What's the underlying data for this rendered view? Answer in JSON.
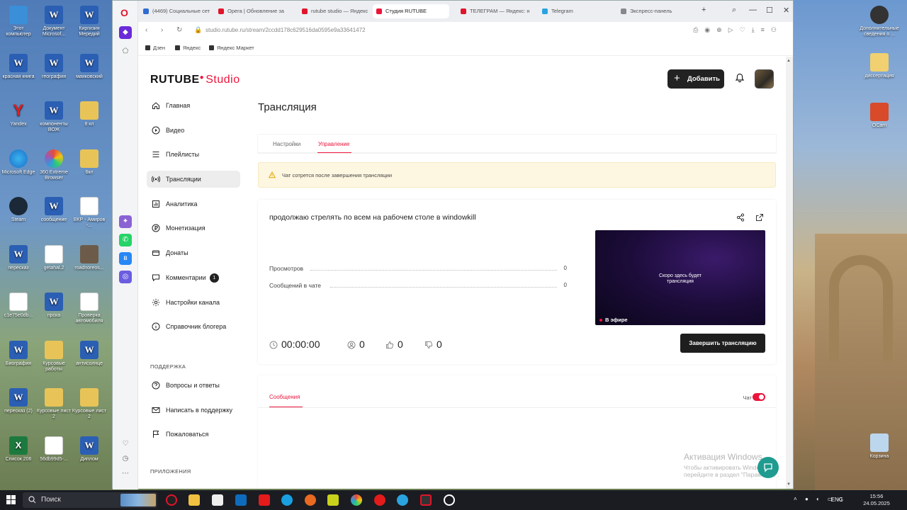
{
  "desktop": {
    "left_icons": [
      {
        "label": "Этот компьютер",
        "kind": "pc"
      },
      {
        "label": "Документ Microsof...",
        "kind": "w"
      },
      {
        "label": "Киргизия Мередий",
        "kind": "w"
      },
      {
        "label": "красная книга",
        "kind": "w"
      },
      {
        "label": "география",
        "kind": "w"
      },
      {
        "label": "маяковский",
        "kind": "w"
      },
      {
        "label": "Yandex",
        "kind": "y"
      },
      {
        "label": "компоненты ВОЖ",
        "kind": "w"
      },
      {
        "label": "8 кл",
        "kind": "f"
      },
      {
        "label": "Microsoft Edge",
        "kind": "c"
      },
      {
        "label": "360 Extreme Browser",
        "kind": "m"
      },
      {
        "label": "6кл",
        "kind": "f"
      },
      {
        "label": "Steam",
        "kind": "s"
      },
      {
        "label": "сообщение",
        "kind": "w"
      },
      {
        "label": "ВКР - Амиров -...",
        "kind": "d"
      },
      {
        "label": "пересказ",
        "kind": "w"
      },
      {
        "label": "getahal.2",
        "kind": "d"
      },
      {
        "label": "roadnoreos...",
        "kind": "p"
      },
      {
        "label": "c1e75e0db...",
        "kind": "d"
      },
      {
        "label": "прска",
        "kind": "w"
      },
      {
        "label": "Проверка автомобиля",
        "kind": "d"
      },
      {
        "label": "Биография",
        "kind": "w"
      },
      {
        "label": "Курсовые работы",
        "kind": "f"
      },
      {
        "label": "антисолнце",
        "kind": "w"
      },
      {
        "label": "пересказ (2)",
        "kind": "w"
      },
      {
        "label": "Курсовые лист 2",
        "kind": "f"
      },
      {
        "label": "Курсовые лист 2",
        "kind": "f"
      },
      {
        "label": "Список 206",
        "kind": "e"
      },
      {
        "label": "56db99d5-...",
        "kind": "d"
      },
      {
        "label": "Диплом",
        "kind": "w"
      }
    ],
    "right_icons": [
      {
        "label": "Дополнительные сведения о ...",
        "kind": "gear"
      },
      {
        "label": "диссертация",
        "kind": "f"
      },
      {
        "label": "OCam",
        "kind": "ocam"
      },
      {
        "label": "Корзина",
        "kind": "bin"
      }
    ]
  },
  "browser": {
    "tabs": [
      {
        "label": "(4469) Социальные сет",
        "color": "#2f6dd1"
      },
      {
        "label": "Opera | Обновление за",
        "color": "#e0152a"
      },
      {
        "label": "rutube studio — Яндекс",
        "color": "#e0152a"
      },
      {
        "label": "Студия RUTUBE",
        "color": "#ed143b"
      },
      {
        "label": "ТЕЛЕГРАМ — Яндекс: н",
        "color": "#e0152a"
      },
      {
        "label": "Telegram",
        "color": "#2aa3e0"
      },
      {
        "label": "Экспресс-панель",
        "color": "#888888"
      }
    ],
    "active_tab": 3,
    "url": "studio.rutube.ru/stream/2ccdd178c629516da0595e9a33641472",
    "bookmarks": [
      "Дзен",
      "Яндекс",
      "Яндекс Маркет"
    ]
  },
  "app": {
    "logo_main": "RUTUBE",
    "logo_studio": "Studio",
    "add_button": "Добавить",
    "menu": [
      {
        "label": "Главная",
        "icon": "home-icon"
      },
      {
        "label": "Видео",
        "icon": "video-icon"
      },
      {
        "label": "Плейлисты",
        "icon": "playlist-icon"
      },
      {
        "label": "Трансляции",
        "icon": "broadcast-icon",
        "active": true
      },
      {
        "label": "Аналитика",
        "icon": "analytics-icon"
      },
      {
        "label": "Монетизация",
        "icon": "monetization-icon"
      },
      {
        "label": "Донаты",
        "icon": "donations-icon"
      },
      {
        "label": "Комментарии",
        "icon": "comments-icon",
        "badge": "1"
      },
      {
        "label": "Настройки канала",
        "icon": "gear-icon"
      },
      {
        "label": "Справочник блогера",
        "icon": "info-icon"
      }
    ],
    "support_title": "ПОДДЕРЖКА",
    "support": [
      {
        "label": "Вопросы и ответы",
        "icon": "help-icon"
      },
      {
        "label": "Написать в поддержку",
        "icon": "mail-icon"
      },
      {
        "label": "Пожаловаться",
        "icon": "flag-icon"
      }
    ],
    "apps_title": "ПРИЛОЖЕНИЯ",
    "page_title": "Трансляция",
    "tabs": [
      "Настройки",
      "Управление"
    ],
    "active_tab": 1,
    "alert": "Чат сотрется после завершения трансляции",
    "stream": {
      "title": "продолжаю стрелять по всем на рабочем столе в windowkill",
      "stats": [
        {
          "label": "Просмотров",
          "value": "0"
        },
        {
          "label": "Сообщений в чате",
          "value": "0"
        }
      ],
      "preview_line1": "Скоро здесь будет",
      "preview_line2": "трансляция",
      "live_label": "В эфире",
      "timer": "00:00:00",
      "viewers": "0",
      "likes": "0",
      "dislikes": "0",
      "end_button": "Завершить трансляцию"
    },
    "chat": {
      "tab_label": "Сообщения",
      "toggle_label": "Чат",
      "enabled": true
    },
    "watermark_line1": "Активация Windows",
    "watermark_line2": "Чтобы активировать Windows, перейдите в раздел \"Параметры\"."
  },
  "taskbar": {
    "search_placeholder": "Поиск",
    "lang": "ENG",
    "time": "15:56",
    "date": "24.05.2025"
  }
}
